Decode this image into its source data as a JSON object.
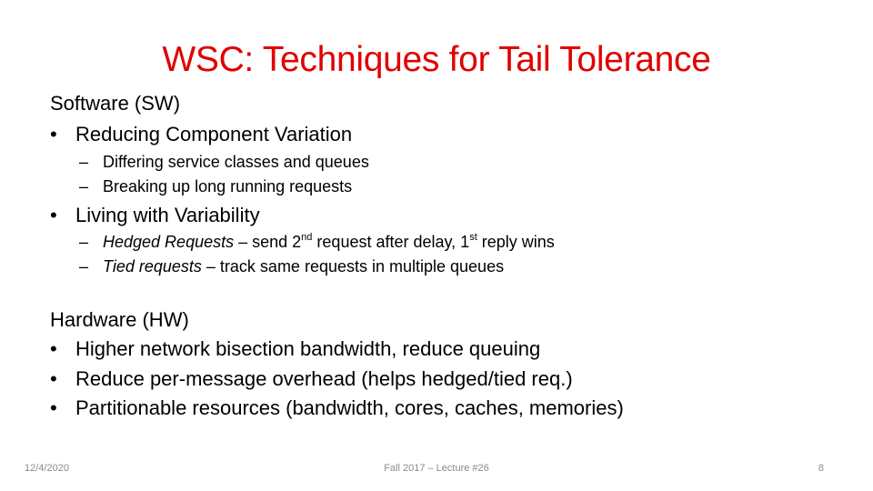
{
  "slide": {
    "title": "WSC: Techniques for Tail Tolerance",
    "software": {
      "heading": "Software (SW)",
      "groups": [
        {
          "label": "Reducing Component Variation",
          "items": [
            "Differing service classes and queues",
            "Breaking up long running requests"
          ]
        },
        {
          "label": "Living with Variability",
          "items": [
            {
              "term": "Hedged Requests",
              "sep": " – ",
              "p1": "send 2",
              "sup1": "nd",
              "p2": " request after delay, 1",
              "sup2": "st",
              "p3": " reply wins"
            },
            {
              "term": "Tied requests",
              "sep": " – ",
              "text": "track same requests in multiple queues"
            }
          ]
        }
      ]
    },
    "hardware": {
      "heading": "Hardware (HW)",
      "items": [
        "Higher network bisection bandwidth, reduce queuing",
        "Reduce per-message overhead (helps hedged/tied req.)",
        "Partitionable resources (bandwidth, cores, caches, memories)"
      ]
    },
    "footer": {
      "date": "12/4/2020",
      "center": "Fall 2017 – Lecture #26",
      "page": "8"
    },
    "bullet_glyph": "•",
    "dash_glyph": "–",
    "colors": {
      "title": "#e00000",
      "text": "#000000",
      "footer": "#8a8a8a"
    }
  }
}
